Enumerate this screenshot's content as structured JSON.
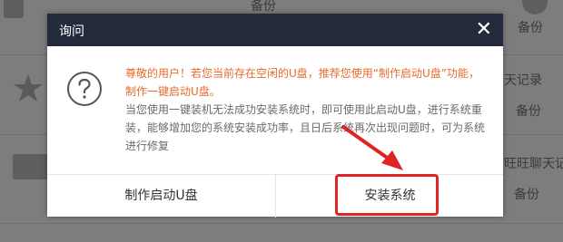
{
  "background": {
    "items": [
      {
        "text": "备份"
      },
      {
        "text": "备份"
      },
      {
        "text": "天记录"
      },
      {
        "text": "备份"
      },
      {
        "text": "旺旺聊天记录"
      },
      {
        "text": "备份"
      }
    ]
  },
  "dialog": {
    "title": "询问",
    "close_symbol": "✕",
    "icon": "question-circle-icon",
    "message_line1": "尊敬的用户！若您当前存在空闲的U盘，推荐您使用“制作启动U盘”功能，制作一键启动U盘。",
    "message_line2": "当您使用一键装机无法成功安装系统时，即可使用此启动U盘，进行系统重装，能够增加您的系统安装成功率，且日后系统再次出现问题时，可为系统进行修复",
    "button_left": "制作启动U盘",
    "button_right": "安装系统"
  },
  "annotation": {
    "highlight_color": "#e02424",
    "arrow_color": "#e02424"
  }
}
